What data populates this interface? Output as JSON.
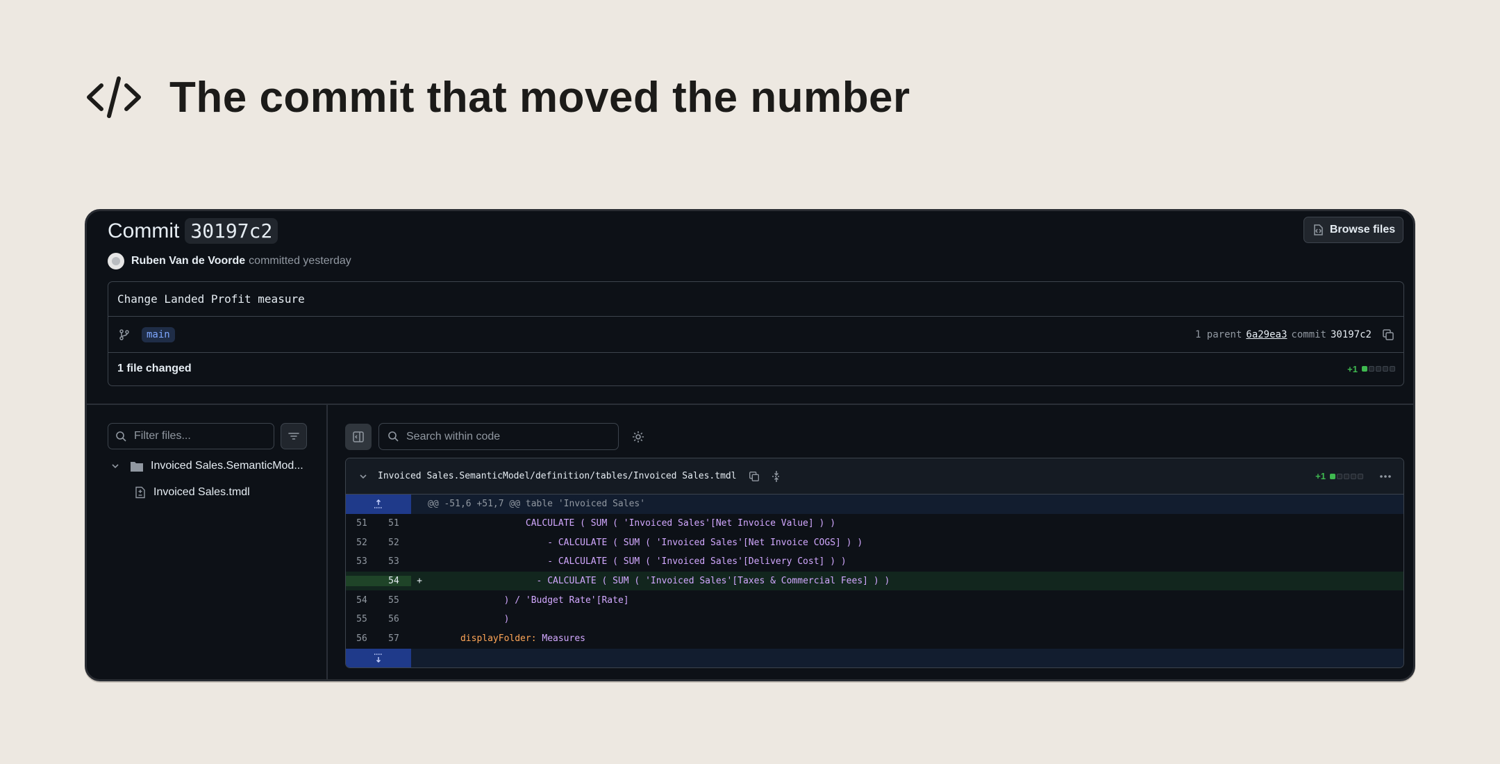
{
  "hero": {
    "title": "The commit that moved the number",
    "icon": "code-icon"
  },
  "commit": {
    "label": "Commit",
    "sha": "30197c2",
    "browse_label": "Browse files",
    "author": "Ruben Van de Voorde",
    "author_action": "committed yesterday",
    "message": "Change Landed Profit measure",
    "branch": "main",
    "parent_label": "1 parent",
    "parent_sha": "6a29ea3",
    "commit_label": "commit",
    "commit_sha": "30197c2",
    "files_changed": "1 file changed",
    "additions": "+1"
  },
  "tree": {
    "filter_placeholder": "Filter files...",
    "folder": "Invoiced Sales.SemanticMod...",
    "file": "Invoiced Sales.tmdl"
  },
  "diff": {
    "search_placeholder": "Search within code",
    "path": "Invoiced Sales.SemanticModel/definition/tables/Invoiced Sales.tmdl",
    "additions": "+1",
    "hunk_header": "@@ -51,6 +51,7 @@ table 'Invoiced Sales'",
    "lines": [
      {
        "old": "51",
        "new": "51",
        "sign": "",
        "indent": "                  ",
        "fn": "CALCULATE ( SUM ( ",
        "str": "'Invoiced Sales'[Net Invoice Value] ) )",
        "type": "ctx"
      },
      {
        "old": "52",
        "new": "52",
        "sign": "",
        "indent": "                      ",
        "fn": "- CALCULATE ( SUM ( ",
        "str": "'Invoiced Sales'[Net Invoice COGS] ) )",
        "type": "ctx"
      },
      {
        "old": "53",
        "new": "53",
        "sign": "",
        "indent": "                      ",
        "fn": "- CALCULATE ( SUM ( ",
        "str": "'Invoiced Sales'[Delivery Cost] ) )",
        "type": "ctx"
      },
      {
        "old": "",
        "new": "54",
        "sign": "+",
        "indent": "                    ",
        "fn": "- CALCULATE ( SUM ( ",
        "str": "'Invoiced Sales'[Taxes & Commercial Fees] ) )",
        "type": "add"
      },
      {
        "old": "54",
        "new": "55",
        "sign": "",
        "indent": "              ",
        "fn": ") / ",
        "str": "'Budget Rate'[Rate]",
        "type": "ctx"
      },
      {
        "old": "55",
        "new": "56",
        "sign": "",
        "indent": "              ",
        "fn": ")",
        "str": "",
        "type": "ctx"
      },
      {
        "old": "56",
        "new": "57",
        "sign": "",
        "indent": "      ",
        "kw": "displayFolder: ",
        "str": "Measures",
        "type": "ctx"
      }
    ]
  }
}
